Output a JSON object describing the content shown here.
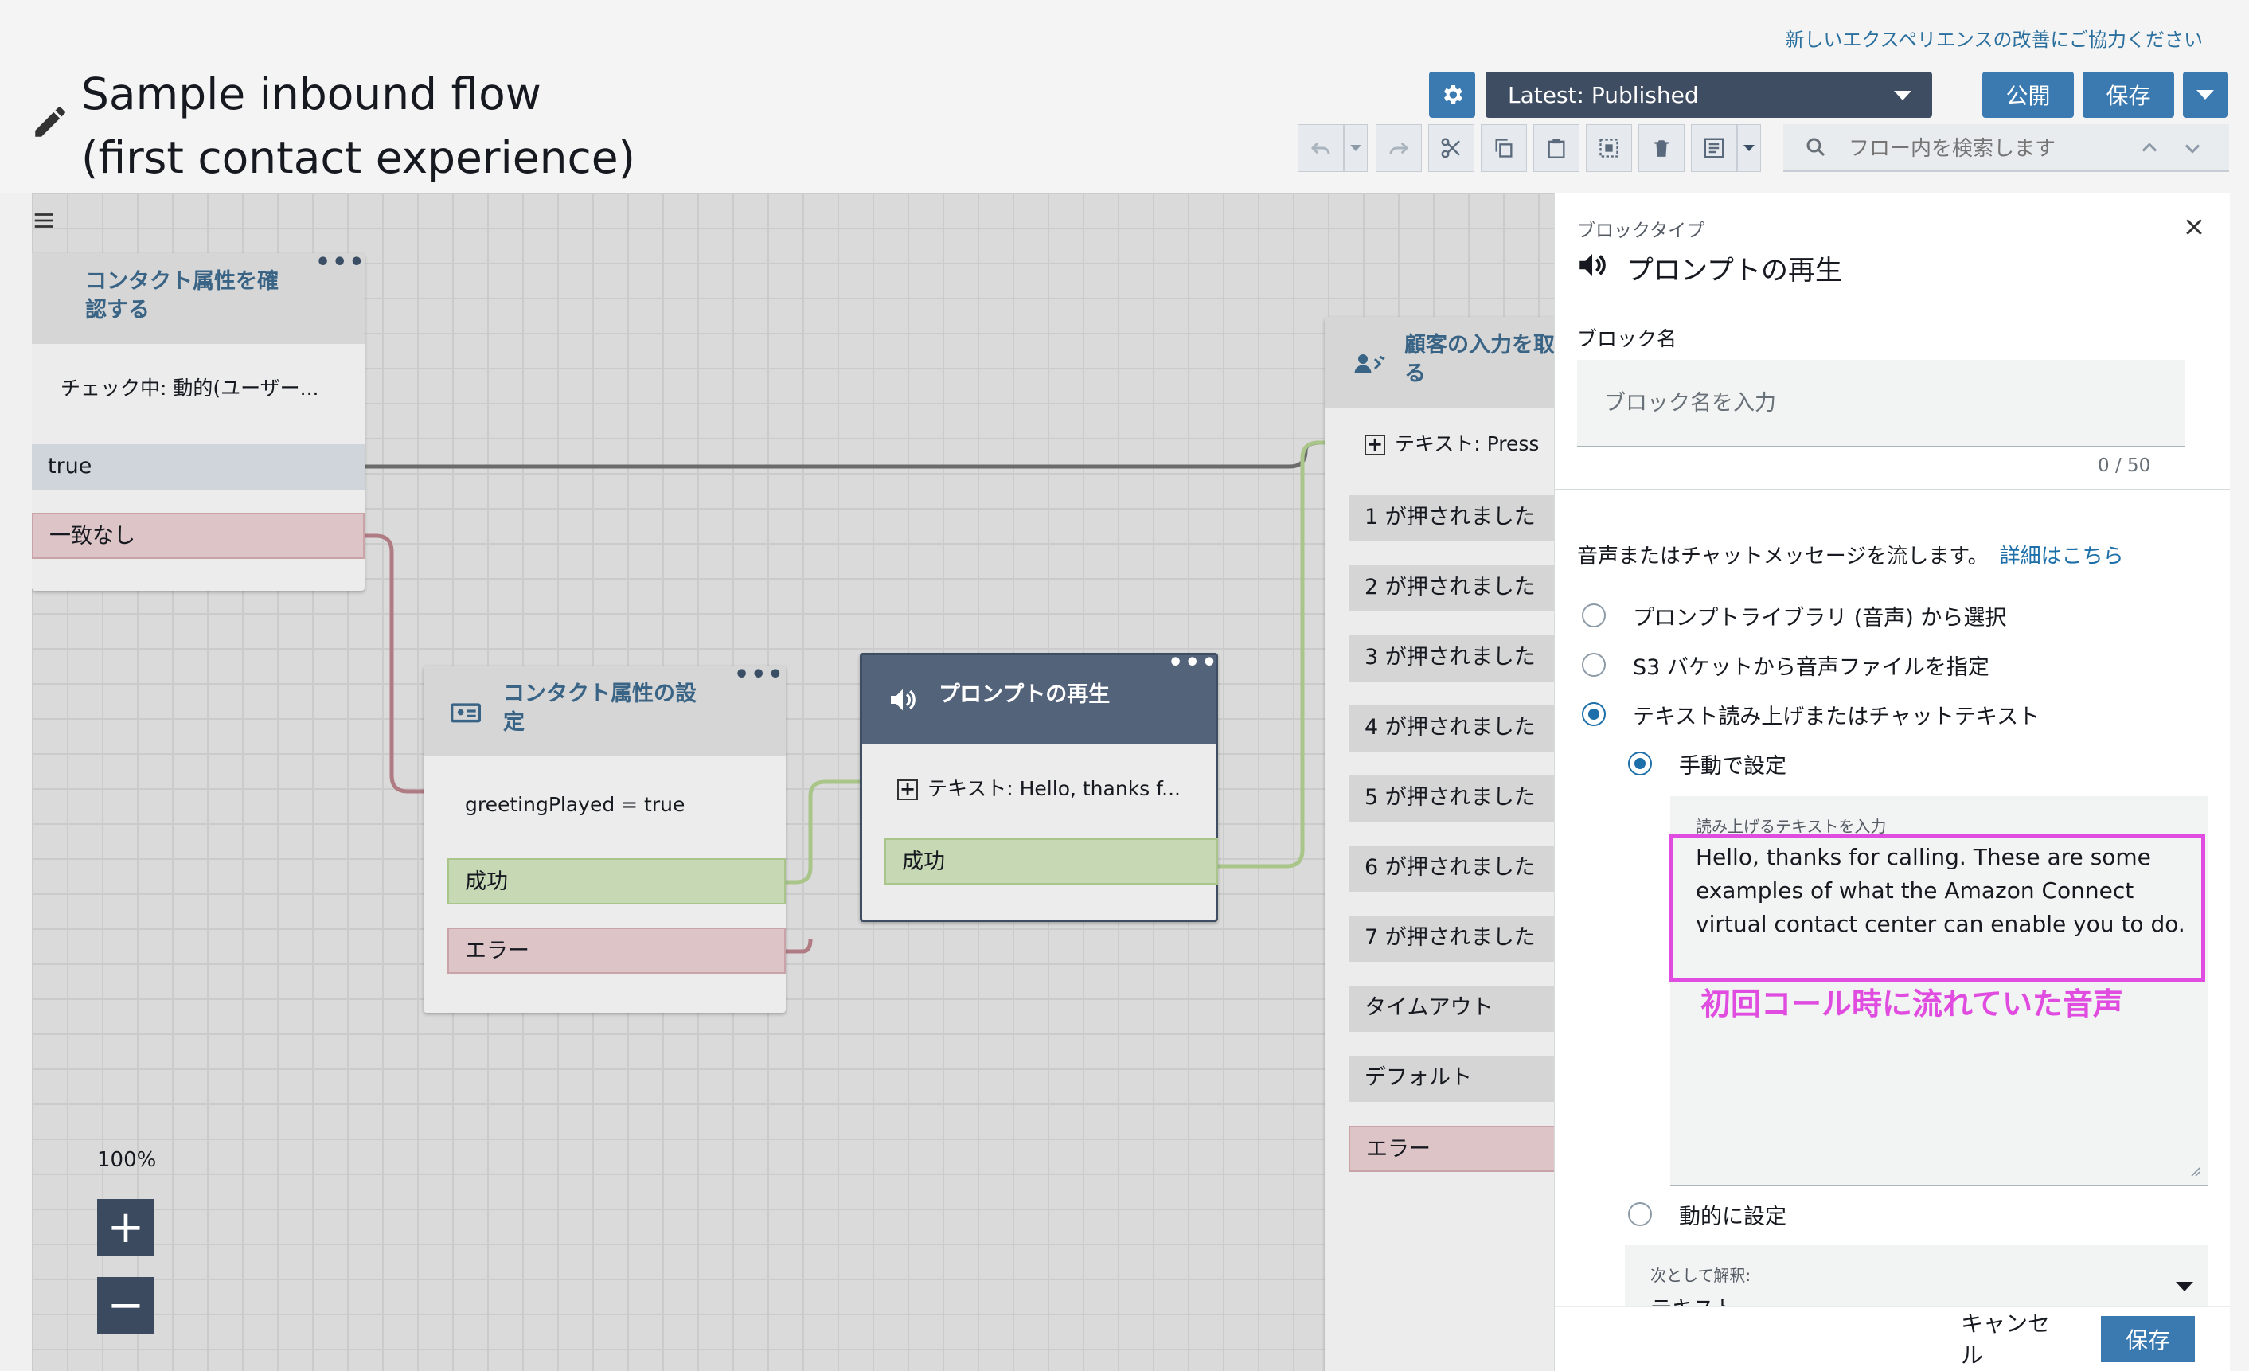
{
  "header": {
    "feedback_link": "新しいエクスペリエンスの改善にご協力ください",
    "title_line1": "Sample inbound flow",
    "title_line2": "(first contact experience)",
    "version_label": "Latest: Published",
    "publish_label": "公開",
    "save_label": "保存"
  },
  "toolbar": {
    "search_placeholder": "フロー内を検索します"
  },
  "canvas": {
    "zoom_level": "100%",
    "block_check_attr": {
      "title_line1": "コンタクト属性を確",
      "title_line2": "認する",
      "condition": "チェック中: 動的(ユーザー...",
      "branches": [
        "true",
        "一致なし"
      ]
    },
    "block_set_attr": {
      "title_line1": "コンタクト属性の設",
      "title_line2": "定",
      "detail": "greetingPlayed = true",
      "branches": [
        "成功",
        "エラー"
      ]
    },
    "block_play_prompt": {
      "title": "プロンプトの再生",
      "detail": "テキスト: Hello, thanks f...",
      "branches": [
        "成功"
      ]
    },
    "block_get_input": {
      "title_line1": "顧客の入力を取",
      "title_line2": "る",
      "detail": "テキスト: Press",
      "branches": [
        "1 が押されました",
        "2 が押されました",
        "3 が押されました",
        "4 が押されました",
        "5 が押されました",
        "6 が押されました",
        "7 が押されました",
        "タイムアウト",
        "デフォルト",
        "エラー"
      ]
    }
  },
  "panel": {
    "block_type_label": "ブロックタイプ",
    "block_type": "プロンプトの再生",
    "block_name_label": "ブロック名",
    "block_name_placeholder": "ブロック名を入力",
    "char_count": "0 / 50",
    "description": "音声またはチャットメッセージを流します。",
    "learn_more": "詳細はこちら",
    "options": [
      "プロンプトライブラリ (音声) から選択",
      "S3 バケットから音声ファイルを指定",
      "テキスト読み上げまたはチャットテキスト"
    ],
    "selected_option": "テキスト読み上げまたはチャットテキスト",
    "sub_options": [
      "手動で設定",
      "動的に設定"
    ],
    "tts_label": "読み上げるテキストを入力",
    "tts_text": "Hello, thanks for calling. These are some examples of what the Amazon Connect virtual contact center can enable you to do.",
    "annotation": "初回コール時に流れていた音声",
    "interpret_label": "次として解釈:",
    "interpret_value": "テキスト",
    "cancel_label": "キャンセル",
    "save_label": "保存"
  },
  "colors": {
    "primary": "#3b7ab0",
    "dark": "#3f4d62",
    "success_branch": "#c7d8b4",
    "error_branch": "#dcc4c7",
    "highlight": "#e04be0"
  }
}
